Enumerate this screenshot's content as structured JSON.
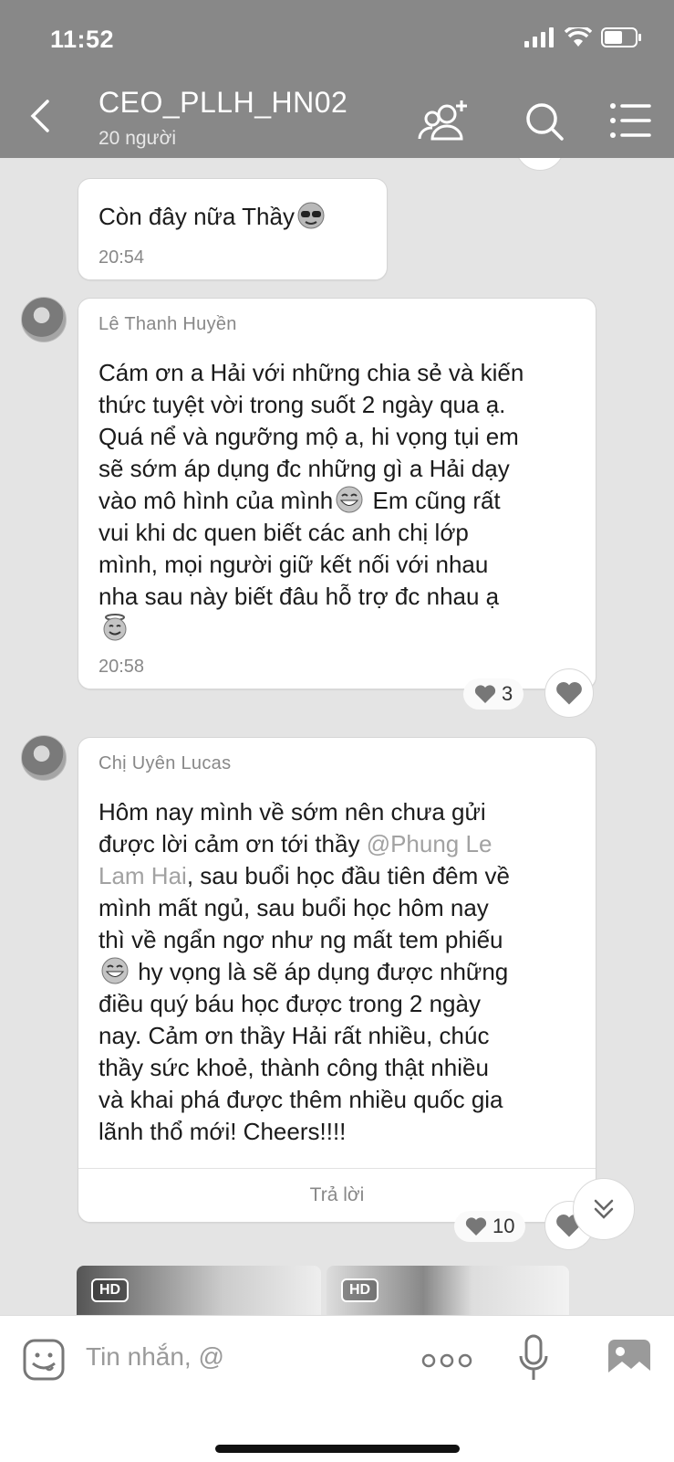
{
  "status": {
    "time": "11:52"
  },
  "header": {
    "title": "CEO_PLLH_HN02",
    "subtitle": "20 người"
  },
  "messages": [
    {
      "text": "Còn đây nữa Thầy",
      "emoji": "sunglasses",
      "time": "20:54"
    },
    {
      "sender": "Lê Thanh Huyền",
      "lines": [
        "Cám ơn a Hải với những chia sẻ và kiến",
        "thức tuyệt vời trong suốt 2 ngày qua ạ.",
        "Quá nể và ngưỡng mộ a, hi vọng tụi em",
        "sẽ sớm áp dụng đc những gì a Hải dạy",
        "vào mô hình của mình",
        " Em cũng rất",
        "vui khi dc quen biết các anh chị lớp",
        "mình, mọi người giữ kết nối với nhau",
        "nha sau này biết đâu hỗ trợ đc nhau ạ"
      ],
      "time": "20:58",
      "reaction_count": "3"
    },
    {
      "sender": "Chị Uyên Lucas",
      "lines": [
        "Hôm nay mình về sớm nên chưa gửi",
        "được lời cảm ơn tới thầy ",
        "@Phung Le",
        "Lam Hai",
        ", sau buổi học đầu tiên đêm về",
        "mình mất ngủ, sau buổi học hôm nay",
        "thì về ngẩn ngơ như ng mất tem phiếu",
        " hy vọng là sẽ áp dụng được những",
        "điều quý báu học được trong 2 ngày",
        "nay. Cảm ơn thầy Hải rất nhiều, chúc",
        "thầy sức khoẻ, thành công thật nhiều",
        "và khai phá được thêm nhiều quốc gia",
        "lãnh thổ mới! Cheers!!!!"
      ],
      "reply_label": "Trả lời",
      "reaction_count": "10"
    }
  ],
  "photos": [
    {
      "badge": "HD"
    },
    {
      "badge": "HD"
    }
  ],
  "input": {
    "placeholder": "Tin nhắn, @"
  }
}
